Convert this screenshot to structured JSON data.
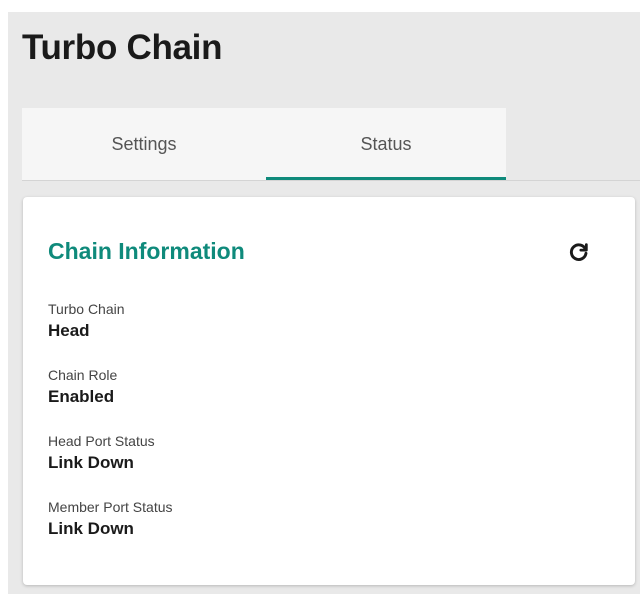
{
  "header": {
    "title": "Turbo Chain"
  },
  "tabs": [
    {
      "label": "Settings",
      "active": false
    },
    {
      "label": "Status",
      "active": true
    }
  ],
  "colors": {
    "accent": "#0f8a7b"
  },
  "card": {
    "title": "Chain Information",
    "refresh_icon": "refresh-icon",
    "fields": [
      {
        "label": "Turbo Chain",
        "value": "Head"
      },
      {
        "label": "Chain Role",
        "value": "Enabled"
      },
      {
        "label": "Head Port Status",
        "value": "Link Down"
      },
      {
        "label": "Member Port Status",
        "value": "Link Down"
      }
    ]
  }
}
